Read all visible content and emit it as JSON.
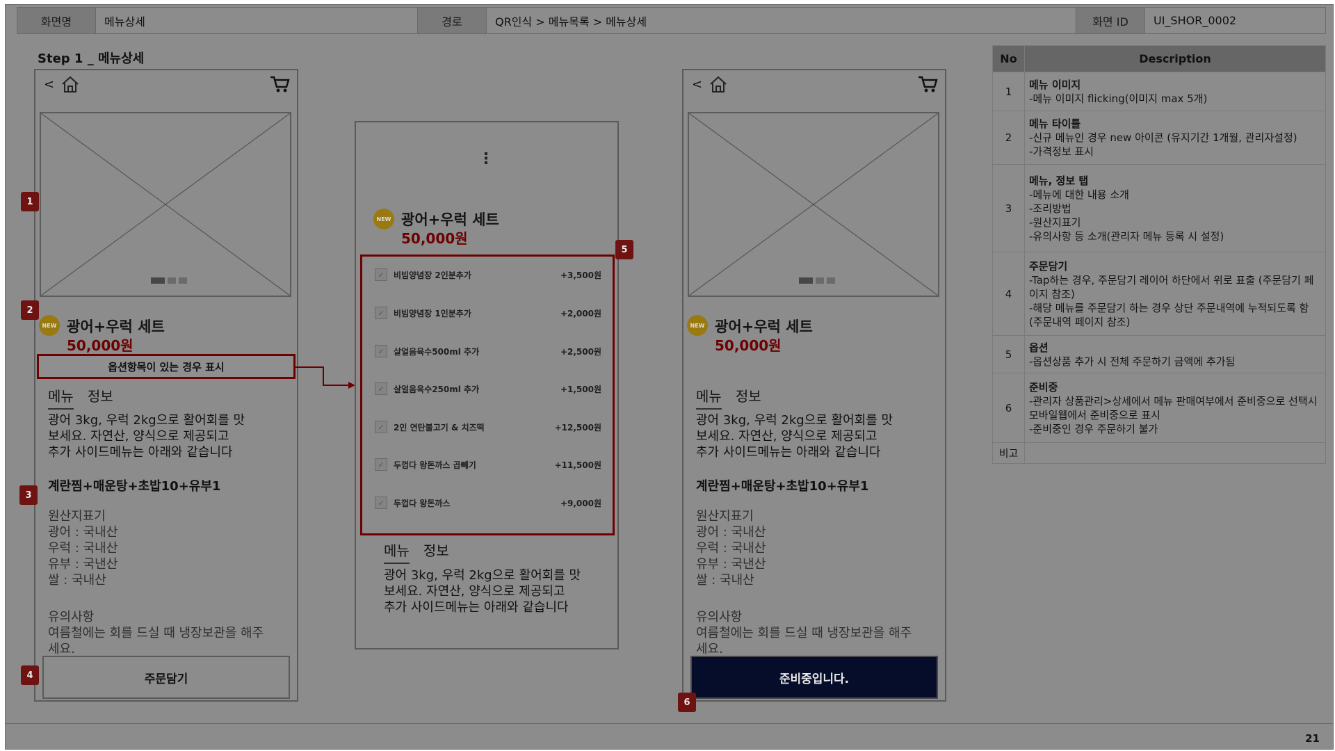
{
  "header": {
    "screen_name_label": "화면명",
    "screen_name_value": "메뉴상세",
    "path_label": "경로",
    "path_value": "QR인식 > 메뉴목록 > 메뉴상세",
    "screen_id_label": "화면 ID",
    "screen_id_value": "UI_SHOR_0002"
  },
  "step_title": "Step 1 _ 메뉴상세",
  "phone": {
    "back": "<",
    "new_badge": "NEW",
    "menu_title": "광어+우럭 세트",
    "price": "50,000원",
    "option_note": "옵션항목이 있는 경우 표시",
    "tab_menu": "메뉴",
    "tab_info": "정보",
    "intro_lines": [
      "광어 3kg, 우럭 2kg으로 활어회를 맛",
      "보세요. 자연산, 양식으로 제공되고",
      "추가 사이드메뉴는 아래와 같습니다"
    ],
    "set_items": "계란찜+매운탕+초밥10+유부1",
    "origin_lines": [
      "원산지표기",
      "광어 : 국내산",
      "우럭 : 국내산",
      "유부 : 국낸산",
      "쌀 : 국내산"
    ],
    "notice_lines": [
      "유의사항",
      "여름철에는 회를 드실 때 냉장보관을 해주",
      "세요."
    ],
    "cart_button": "주문담기",
    "prep_button": "준비중입니다.",
    "kebab": "⋮"
  },
  "options": [
    {
      "name": "비빔양념장 2인분추가",
      "price": "+3,500원"
    },
    {
      "name": "비빔양념장 1인분추가",
      "price": "+2,000원"
    },
    {
      "name": "살얼음육수500ml 추가",
      "price": "+2,500원"
    },
    {
      "name": "살얼음육수250ml 추가",
      "price": "+1,500원"
    },
    {
      "name": "2인 연탄불고기 & 치즈떡",
      "price": "+12,500원"
    },
    {
      "name": "두껍다 왕돈까스 곱빼기",
      "price": "+11,500원"
    },
    {
      "name": "두껍다 왕돈까스",
      "price": "+9,000원"
    }
  ],
  "markers": [
    "1",
    "2",
    "3",
    "4",
    "5",
    "6"
  ],
  "desc_table": {
    "col_no": "No",
    "col_desc": "Description",
    "rows": [
      {
        "no": "1",
        "title": "메뉴 이미지",
        "lines": [
          "-메뉴 이미지 flicking(이미지 max 5개)"
        ]
      },
      {
        "no": "2",
        "title": "메뉴 타이틀",
        "lines": [
          "-신규 메뉴인 경우 new 아이콘 (유지기간 1개월, 관리자설정)",
          "-가격정보 표시"
        ]
      },
      {
        "no": "3",
        "title": "메뉴, 정보 탭",
        "lines": [
          "-메뉴에 대한 내용 소개",
          "-조리방법",
          "-원산지표기",
          "-유의사항 등 소개(관리자 메뉴 등록 시 설정)"
        ]
      },
      {
        "no": "4",
        "title": "주문담기",
        "lines": [
          "-Tap하는 경우, 주문담기 레이어 하단에서 위로 표출 (주문담기 페이지 참조)",
          "-해당 메뉴를 주문담기 하는 경우 상단 주문내역에 누적되도록 함 (주문내역 페이지 참조)"
        ]
      },
      {
        "no": "5",
        "title": "옵션",
        "lines": [
          "-옵션상품 추가 시 전체 주문하기 금액에 추가됨"
        ]
      },
      {
        "no": "6",
        "title": "준비중",
        "lines": [
          "-관리자 상품관리>상세에서 메뉴 판매여부에서 준비중으로 선택시 모바일웹에서 준비중으로 표시",
          "-준비중인 경우 주문하기 불가"
        ]
      }
    ],
    "remark_label": "비고"
  },
  "page_number": "21"
}
